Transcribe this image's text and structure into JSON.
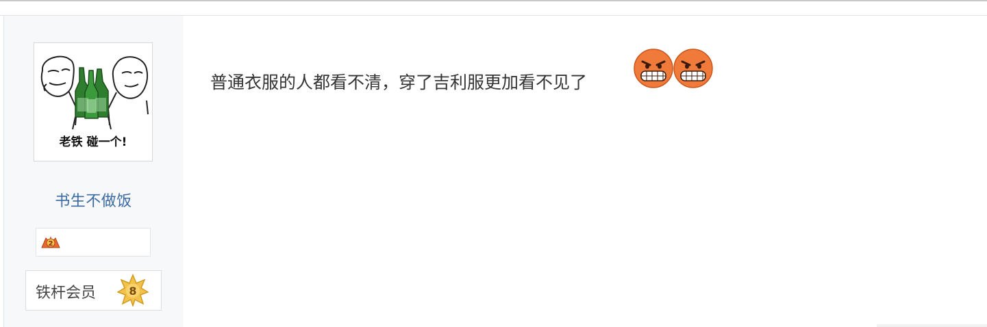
{
  "author": {
    "avatar_caption": "老铁 碰一个!",
    "username": "书生不做饭",
    "fan_badge_level": "2",
    "member_title": "铁杆会员",
    "member_level": "8"
  },
  "post": {
    "text": "普通衣服的人都看不清，穿了吉利服更加看不见了",
    "emojis": [
      "angry-grin-emoji",
      "angry-grin-emoji"
    ]
  },
  "colors": {
    "username": "#3b6aa3",
    "sidebar_bg": "#f7f8fa",
    "emoji": "#f07a3a",
    "star": "#f3c24c"
  }
}
